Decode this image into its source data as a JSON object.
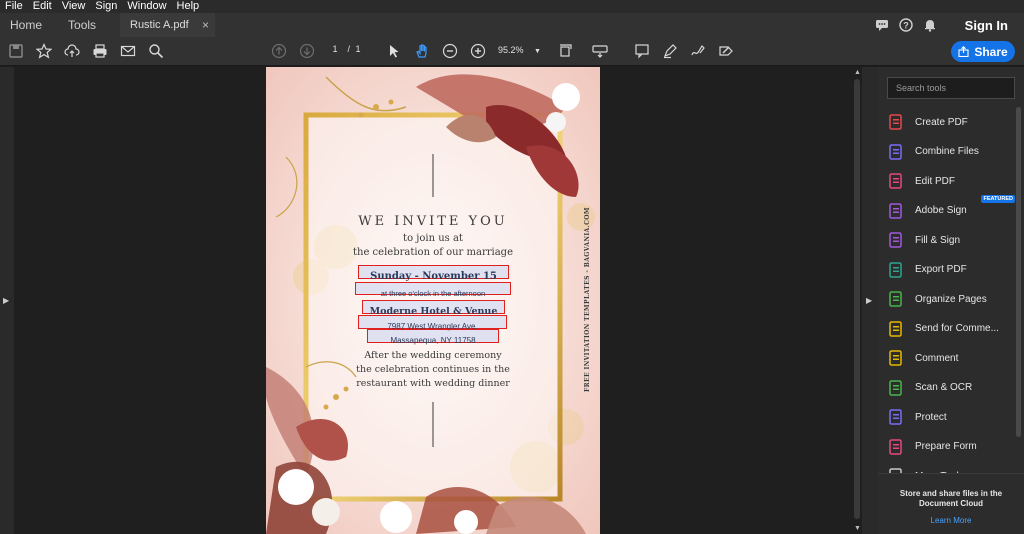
{
  "menu": [
    "File",
    "Edit",
    "View",
    "Sign",
    "Window",
    "Help"
  ],
  "tabs": {
    "home": "Home",
    "tools": "Tools",
    "document": "Rustic A.pdf",
    "close": "×"
  },
  "header": {
    "signin": "Sign In"
  },
  "toolbar": {
    "page_current": "1",
    "page_sep": "/",
    "page_total": "1",
    "zoom": "95.2%",
    "share_label": "Share"
  },
  "tools_panel": {
    "search_placeholder": "Search tools",
    "items": [
      {
        "label": "Create PDF",
        "icon": "create-pdf-icon",
        "color": "#e5484d"
      },
      {
        "label": "Combine Files",
        "icon": "combine-files-icon",
        "color": "#7b6cf6"
      },
      {
        "label": "Edit PDF",
        "icon": "edit-pdf-icon",
        "color": "#e34881"
      },
      {
        "label": "Adobe Sign",
        "icon": "adobe-sign-icon",
        "color": "#9f5bd9",
        "badge": "FEATURED"
      },
      {
        "label": "Fill & Sign",
        "icon": "fill-sign-icon",
        "color": "#9f5bd9"
      },
      {
        "label": "Export PDF",
        "icon": "export-pdf-icon",
        "color": "#2fa58f"
      },
      {
        "label": "Organize Pages",
        "icon": "organize-pages-icon",
        "color": "#4bb34b"
      },
      {
        "label": "Send for Comme...",
        "icon": "send-comment-icon",
        "color": "#e6b800"
      },
      {
        "label": "Comment",
        "icon": "comment-icon",
        "color": "#e6b800"
      },
      {
        "label": "Scan & OCR",
        "icon": "scan-ocr-icon",
        "color": "#4bb34b"
      },
      {
        "label": "Protect",
        "icon": "protect-icon",
        "color": "#7b6cf6"
      },
      {
        "label": "Prepare Form",
        "icon": "prepare-form-icon",
        "color": "#e34881"
      },
      {
        "label": "More Tools",
        "icon": "more-tools-icon",
        "color": "#c8c8c8"
      }
    ],
    "cloud_text": "Store and share files in the Document Cloud",
    "learn_more": "Learn More"
  },
  "invitation": {
    "heading": "WE INVITE YOU",
    "line1": "to join us at",
    "line2": "the celebration of our marriage",
    "date": "Sunday - November 15",
    "time": "at three o'clock in the afternoon",
    "venue": "Moderne Hotel & Venue",
    "address1": "7987 West Wrangler Ave.",
    "address2": "Massapequa, NY 11758",
    "after1": "After the wedding ceremony",
    "after2": "the celebration continues in the",
    "after3": "restaurant with wedding dinner",
    "side_text": "FREE INVITATION TEMPLATES - BAGVANIA.COM"
  }
}
